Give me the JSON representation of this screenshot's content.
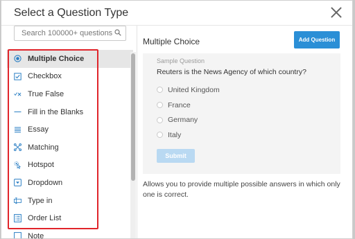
{
  "dialog": {
    "title": "Select a Question Type"
  },
  "search": {
    "placeholder": "Search 100000+ questions"
  },
  "question_types": [
    {
      "label": "Multiple Choice",
      "icon": "radio-icon",
      "selected": true
    },
    {
      "label": "Checkbox",
      "icon": "checkbox-icon"
    },
    {
      "label": "True False",
      "icon": "check-cross-icon"
    },
    {
      "label": "Fill in the Blanks",
      "icon": "dash-icon"
    },
    {
      "label": "Essay",
      "icon": "lines-icon"
    },
    {
      "label": "Matching",
      "icon": "matching-icon"
    },
    {
      "label": "Hotspot",
      "icon": "hotspot-icon"
    },
    {
      "label": "Dropdown",
      "icon": "dropdown-icon"
    },
    {
      "label": "Type in",
      "icon": "type-in-icon"
    },
    {
      "label": "Order List",
      "icon": "order-list-icon"
    },
    {
      "label": "Note",
      "icon": "note-icon"
    }
  ],
  "preview": {
    "title": "Multiple Choice",
    "add_button": "Add Question",
    "sample_label": "Sample Question",
    "question": "Reuters is the News Agency of which country?",
    "options": [
      "United Kingdom",
      "France",
      "Germany",
      "Italy"
    ],
    "submit": "Submit",
    "description": "Allows you to provide multiple possible answers in which only one is correct."
  },
  "colors": {
    "accent": "#2b8fd6",
    "highlight_box": "#e0242a",
    "icon": "#2b7fc4"
  }
}
